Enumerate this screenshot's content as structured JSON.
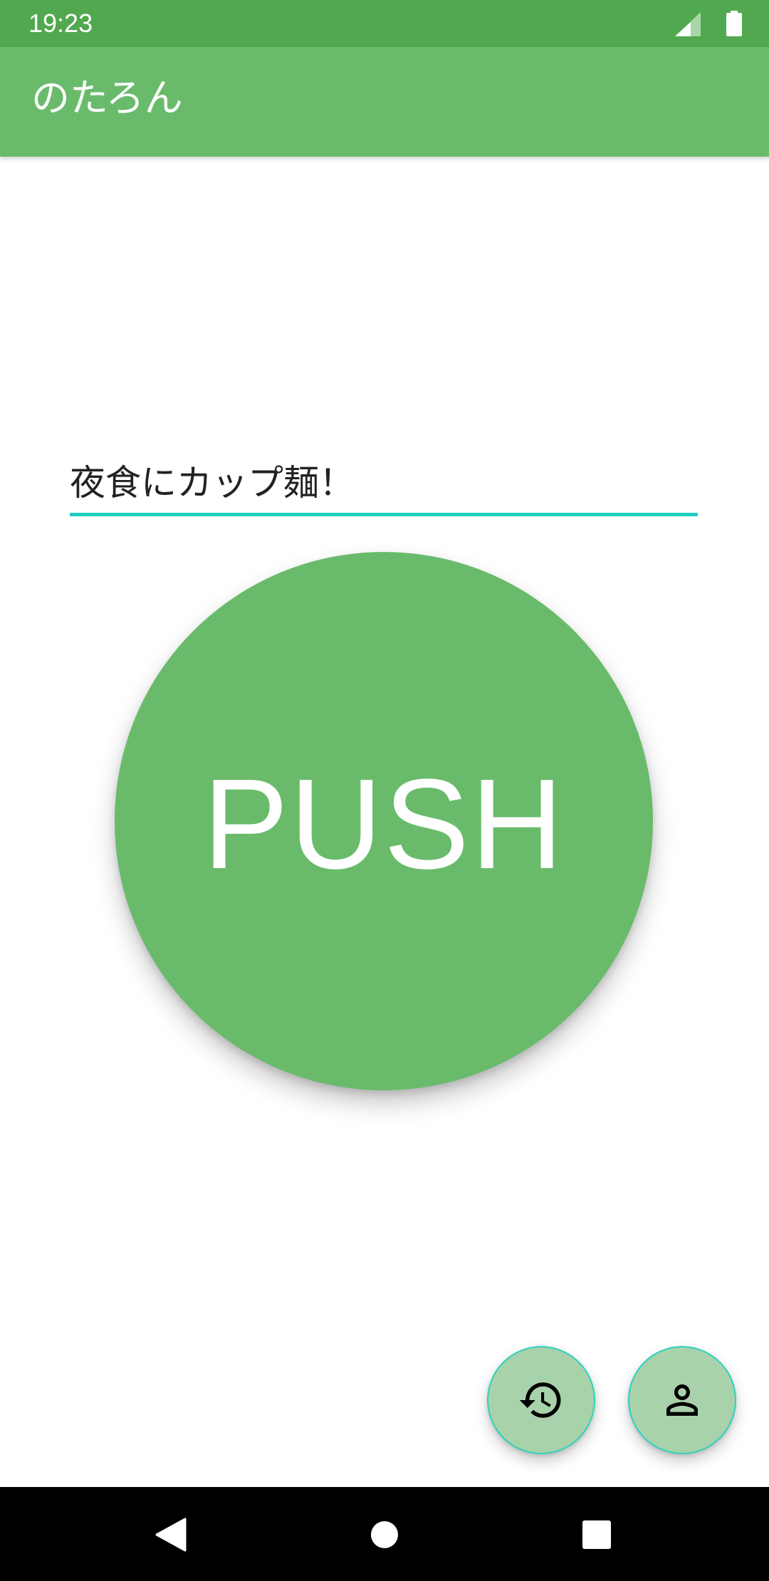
{
  "status_bar": {
    "time": "19:23",
    "icons": [
      "cellular-signal-icon",
      "battery-icon"
    ]
  },
  "app_bar": {
    "title": "のたろん"
  },
  "main": {
    "message_field": {
      "value": "夜食にカップ麺！"
    },
    "push_button": {
      "label": "PUSH"
    },
    "fabs": [
      {
        "name": "history-icon"
      },
      {
        "name": "account-icon"
      }
    ]
  },
  "nav_bar": {
    "buttons": [
      "back-icon",
      "home-icon",
      "recents-icon"
    ]
  },
  "colors": {
    "status_bar": "#52a84f",
    "app_bar": "#69bb6b",
    "push_button": "#69bb6b",
    "fab": "#a8d2a9",
    "accent_underline": "#1ecfbe"
  }
}
